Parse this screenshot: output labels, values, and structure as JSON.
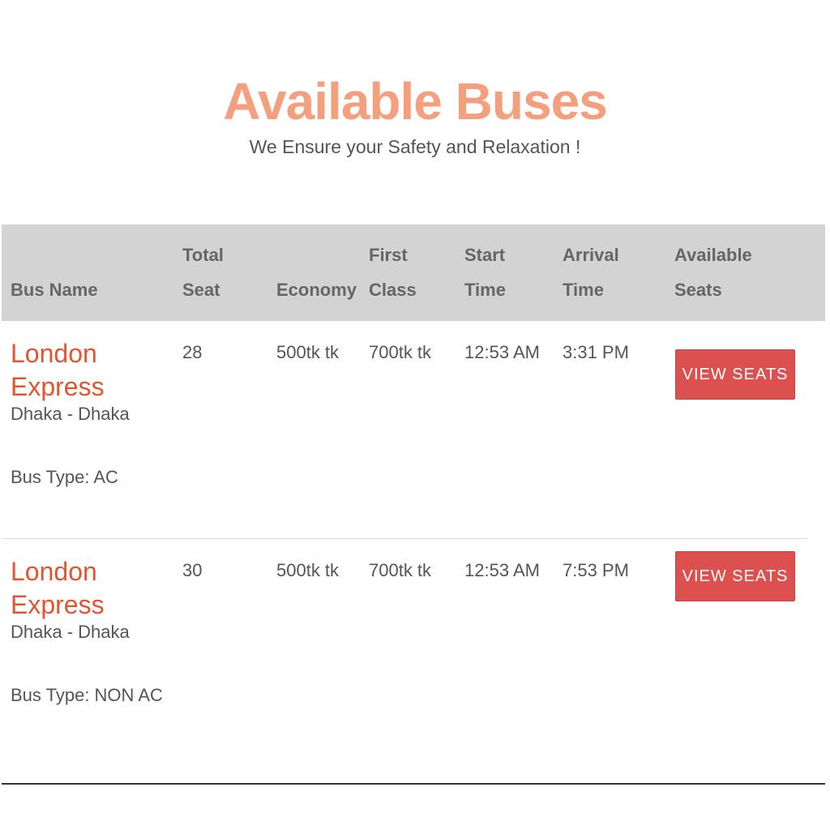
{
  "header": {
    "title": "Available Buses",
    "subtitle": "We Ensure your Safety and Relaxation !"
  },
  "table": {
    "columns": [
      {
        "line1": "",
        "line2": "Bus Name"
      },
      {
        "line1": "Total",
        "line2": "Seat"
      },
      {
        "line1": "",
        "line2": "Economy"
      },
      {
        "line1": "First",
        "line2": "Class"
      },
      {
        "line1": "Start",
        "line2": "Time"
      },
      {
        "line1": "Arrival",
        "line2": "Time"
      },
      {
        "line1": "Available",
        "line2": "Seats"
      }
    ],
    "rows": [
      {
        "name_line1": "London",
        "name_line2": "Express",
        "route": "Dhaka - Dhaka",
        "bus_type": "Bus Type: AC",
        "total_seat": "28",
        "economy": "500tk tk",
        "first_class": "700tk tk",
        "start_time": "12:53 AM",
        "arrival_time": "3:31 PM",
        "button_label": "VIEW SEATS"
      },
      {
        "name_line1": "London",
        "name_line2": "Express",
        "route": "Dhaka - Dhaka",
        "bus_type": "Bus Type: NON AC",
        "total_seat": "30",
        "economy": "500tk tk",
        "first_class": "700tk tk",
        "start_time": "12:53 AM",
        "arrival_time": "7:53 PM",
        "button_label": "VIEW SEATS"
      }
    ]
  },
  "colors": {
    "title": "#f4a07e",
    "bus_name": "#e2562f",
    "button": "#dd5050",
    "header_bg": "#d3d3d3"
  }
}
